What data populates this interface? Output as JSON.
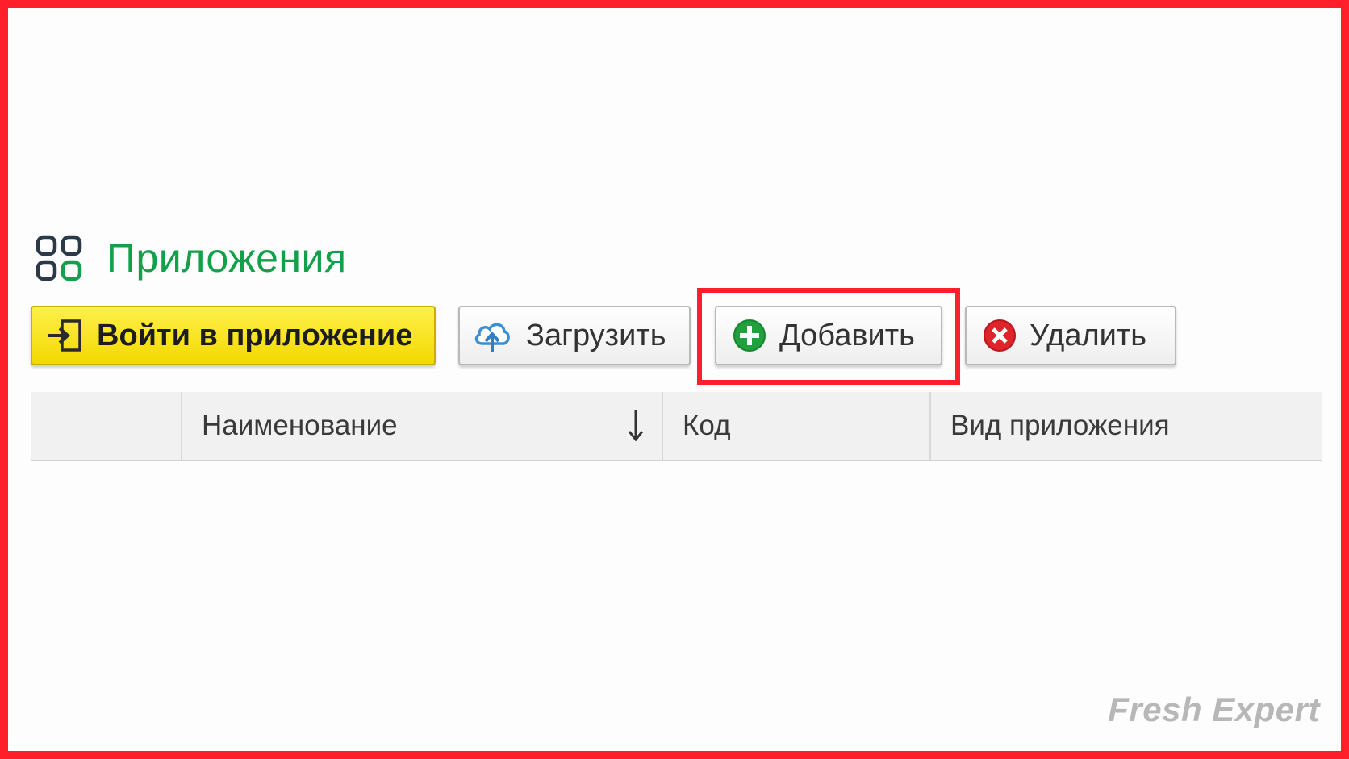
{
  "page": {
    "title": "Приложения",
    "title_icon": "apps-grid-icon",
    "accent_color": "#12a04a",
    "frame_color": "#ff1f2a"
  },
  "toolbar": {
    "enter_label": "Войти в приложение",
    "enter_icon": "login-arrow-icon",
    "upload_label": "Загрузить",
    "upload_icon": "cloud-upload-icon",
    "add_label": "Добавить",
    "add_icon": "plus-circle-icon",
    "delete_label": "Удалить",
    "delete_icon": "delete-x-circle-icon",
    "highlighted_button": "add"
  },
  "table": {
    "columns": [
      {
        "label": ""
      },
      {
        "label": "Наименование",
        "sort": "descending"
      },
      {
        "label": "Код"
      },
      {
        "label": "Вид приложения"
      }
    ],
    "rows": []
  },
  "watermark": "Fresh Expert"
}
